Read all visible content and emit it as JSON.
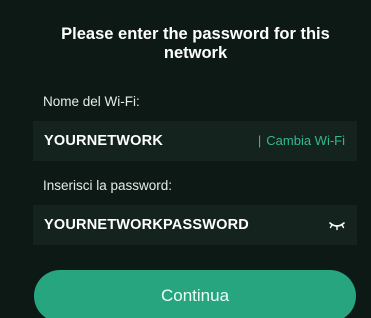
{
  "dialog": {
    "title": "Please enter the password for this network"
  },
  "network_name": {
    "label": "Nome del Wi-Fi:",
    "value": "YOURNETWORK",
    "separator": "|",
    "change_label": "Cambia Wi-Fi"
  },
  "password": {
    "label": "Inserisci la password:",
    "value": "YOURNETWORKPASSWORD",
    "visibility_icon": "eye-closed-icon"
  },
  "actions": {
    "continue_label": "Continua"
  },
  "colors": {
    "background": "#0d1915",
    "field_background": "#14231e",
    "accent": "#33b891",
    "button": "#27a57f",
    "text": "#ffffff"
  }
}
